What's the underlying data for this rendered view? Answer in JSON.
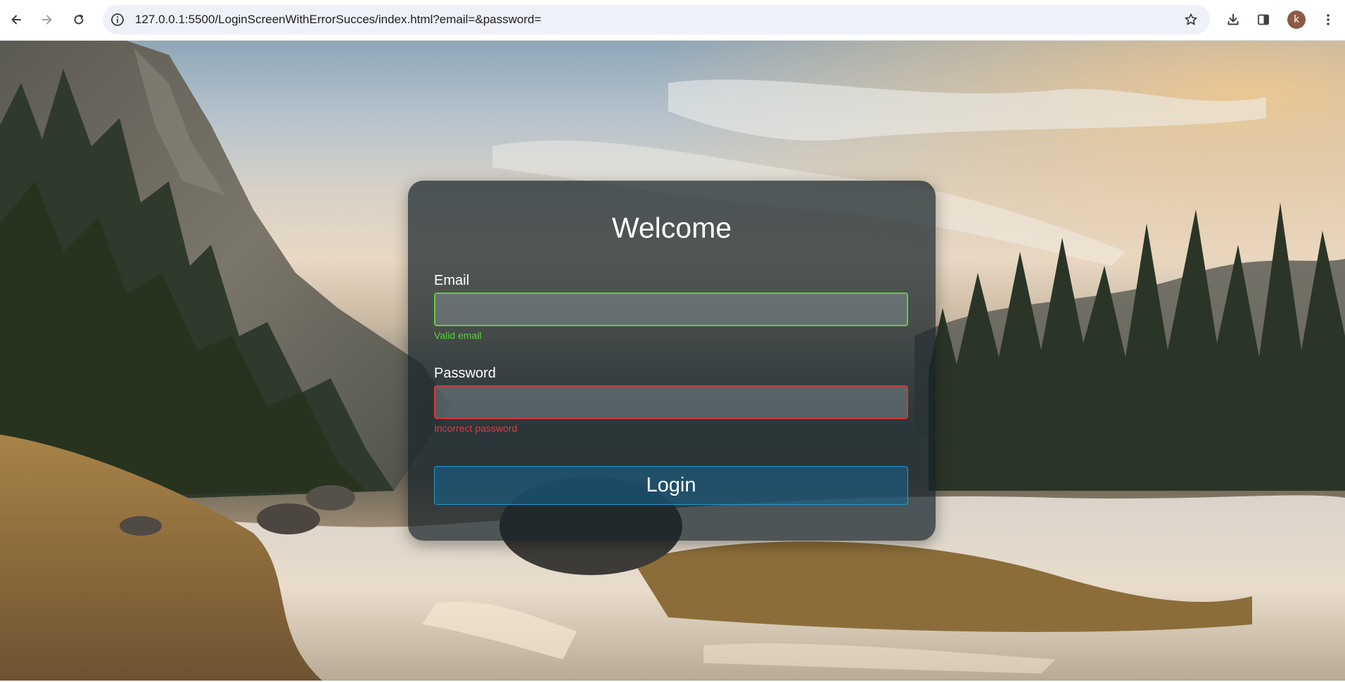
{
  "browser": {
    "url": "127.0.0.1:5500/LoginScreenWithErrorSucces/index.html?email=&password=",
    "profile_initial": "k",
    "icons": {
      "back": "back-arrow-icon",
      "forward": "forward-arrow-icon",
      "reload": "reload-icon",
      "site_info": "info-icon",
      "bookmark": "star-icon",
      "downloads": "download-icon",
      "side_panel": "side-panel-icon",
      "menu": "kebab-menu-icon"
    }
  },
  "login": {
    "title": "Welcome",
    "email_label": "Email",
    "email_value": "",
    "email_message": "Valid email",
    "password_label": "Password",
    "password_value": "",
    "password_message": "Incorrect password",
    "button_label": "Login"
  },
  "colors": {
    "valid": "#5fcf3d",
    "error": "#d6353a",
    "button_border": "#1f9ad6"
  }
}
